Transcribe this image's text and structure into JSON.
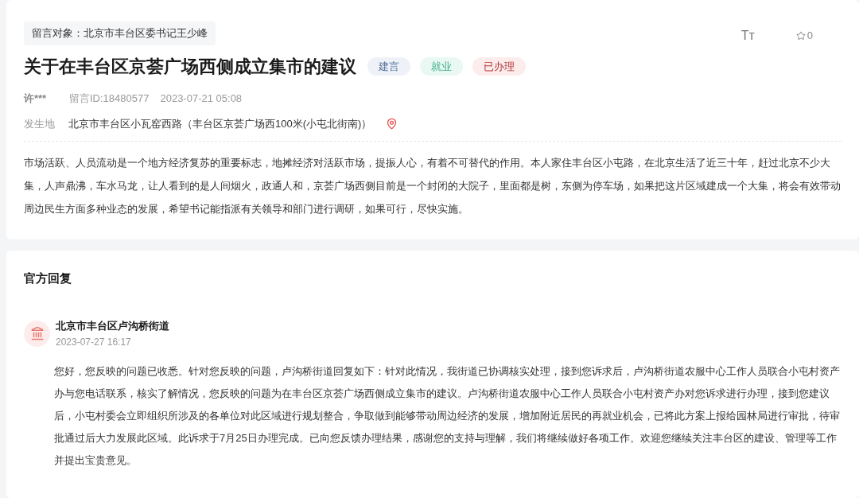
{
  "message": {
    "recipient": "留言对象：北京市丰台区委书记王少峰",
    "title": "关于在丰台区京荟广场西侧成立集市的建议",
    "tags": [
      {
        "label": "建言",
        "color": "#eef2f8"
      },
      {
        "label": "就业",
        "color": "#e9f8f3"
      },
      {
        "label": "已办理",
        "color": "#fdecec"
      }
    ],
    "font_toggle": "Tт",
    "favorite_count": "0",
    "author": "许***",
    "message_id": "留言ID:18480577",
    "time": "2023-07-21 05:08",
    "location_label": "发生地",
    "location": "北京市丰台区小瓦窑西路（丰台区京荟广场西100米(小屯北街南)）",
    "body": "市场活跃、人员流动是一个地方经济复苏的重要标志，地摊经济对活跃市场，提振人心，有着不可替代的作用。本人家住丰台区小屯路，在北京生活了近三十年，赶过北京不少大集，人声鼎沸，车水马龙，让人看到的是人间烟火，政通人和，京荟广场西侧目前是一个封闭的大院子，里面都是树，东侧为停车场，如果把这片区域建成一个大集，将会有效带动周边民生方面多种业态的发展，希望书记能指派有关领导和部门进行调研，如果可行，尽快实施。"
  },
  "reply": {
    "heading": "官方回复",
    "department": "北京市丰台区卢沟桥街道",
    "time": "2023-07-27 16:17",
    "body": "您好，您反映的问题已收悉。针对您反映的问题，卢沟桥街道回复如下：针对此情况，我街道已协调核实处理，接到您诉求后，卢沟桥街道农服中心工作人员联合小屯村资产办与您电话联系，核实了解情况，您反映的问题为在丰台区京荟广场西侧成立集市的建议。卢沟桥街道农服中心工作人员联合小屯村资产办对您诉求进行办理，接到您建议后，小屯村委会立即组织所涉及的各单位对此区域进行规划整合，争取做到能够带动周边经济的发展，增加附近居民的再就业机会，已将此方案上报给园林局进行审批，待审批通过后大力发展此区域。此诉求于7月25日办理完成。已向您反馈办理结果，感谢您的支持与理解，我们将继续做好各项工作。欢迎您继续关注丰台区的建设、管理等工作并提出宝贵意见。"
  }
}
